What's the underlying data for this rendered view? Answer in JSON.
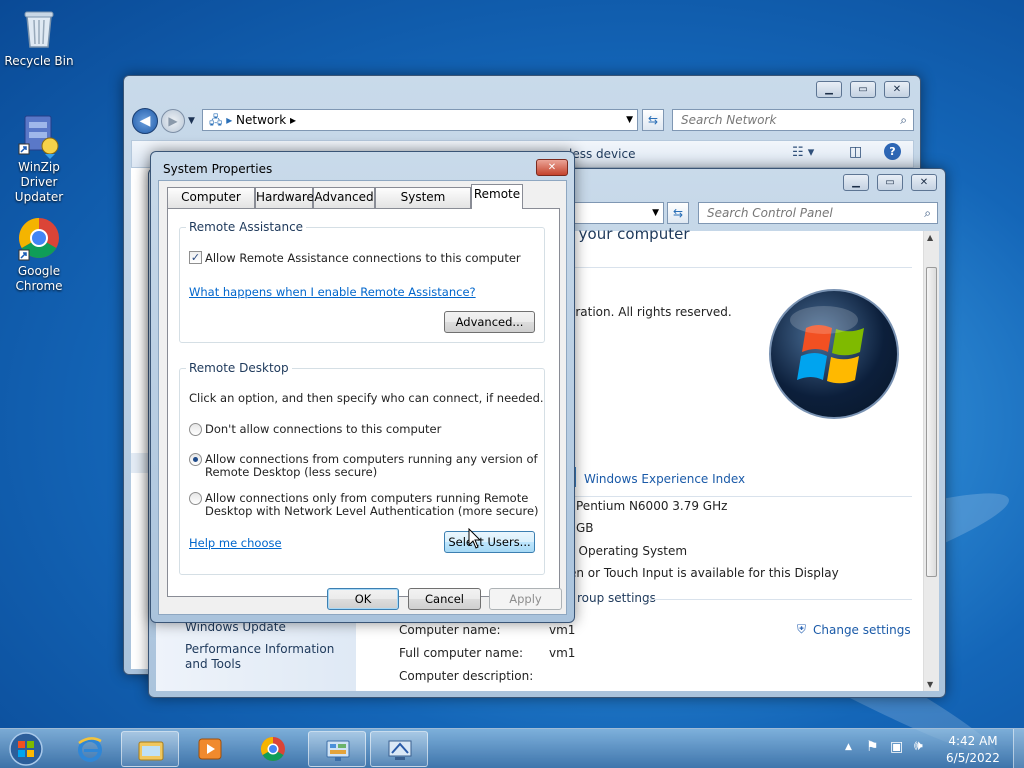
{
  "desktop": {
    "icons": [
      {
        "label": "Recycle Bin"
      },
      {
        "label": "WinZip Driver Updater"
      },
      {
        "label": "Google Chrome"
      }
    ]
  },
  "network_window": {
    "address": "Network",
    "search_placeholder": "Search Network",
    "toolbar_partial": "less device"
  },
  "control_panel_window": {
    "search_placeholder": "Search Control Panel",
    "heading_partial": "t your computer",
    "copyright_partial": "oration.  All rights reserved.",
    "wei_link": "Windows Experience Index",
    "processor_partial": "Pentium N6000   3.79 GHz",
    "memory_partial": "GB",
    "system_type_partial": "t Operating System",
    "pen_partial": "en or Touch Input is available for this Display",
    "group_partial": "roup settings",
    "change_settings": "Change settings",
    "side_links": [
      "Windows Update",
      "Performance Information and Tools"
    ],
    "rows": [
      {
        "label": "Computer name:",
        "value": "vm1"
      },
      {
        "label": "Full computer name:",
        "value": "vm1"
      },
      {
        "label": "Computer description:",
        "value": ""
      }
    ]
  },
  "dialog": {
    "title": "System Properties",
    "tabs": [
      "Computer Name",
      "Hardware",
      "Advanced",
      "System Protection",
      "Remote"
    ],
    "active_tab": "Remote",
    "remote_assistance": {
      "title": "Remote Assistance",
      "checkbox_label": "Allow Remote Assistance connections to this computer",
      "checked": true,
      "link": "What happens when I enable Remote Assistance?",
      "advanced_button": "Advanced..."
    },
    "remote_desktop": {
      "title": "Remote Desktop",
      "intro": "Click an option, and then specify who can connect, if needed.",
      "options": [
        {
          "line1": "Don't allow connections to this computer",
          "line2": "",
          "selected": false
        },
        {
          "line1": "Allow connections from computers running any version of",
          "line2": "Remote Desktop (less secure)",
          "selected": true
        },
        {
          "line1": "Allow connections only from computers running Remote",
          "line2": "Desktop with Network Level Authentication (more secure)",
          "selected": false
        }
      ],
      "help_link": "Help me choose",
      "select_users_button": "Select Users..."
    },
    "buttons": {
      "ok": "OK",
      "cancel": "Cancel",
      "apply": "Apply"
    }
  },
  "taskbar": {
    "time": "4:42 AM",
    "date": "6/5/2022"
  },
  "colors": {
    "link": "#0066cc",
    "close_red": "#c4432c",
    "desktop_blue": "#1466b8"
  }
}
